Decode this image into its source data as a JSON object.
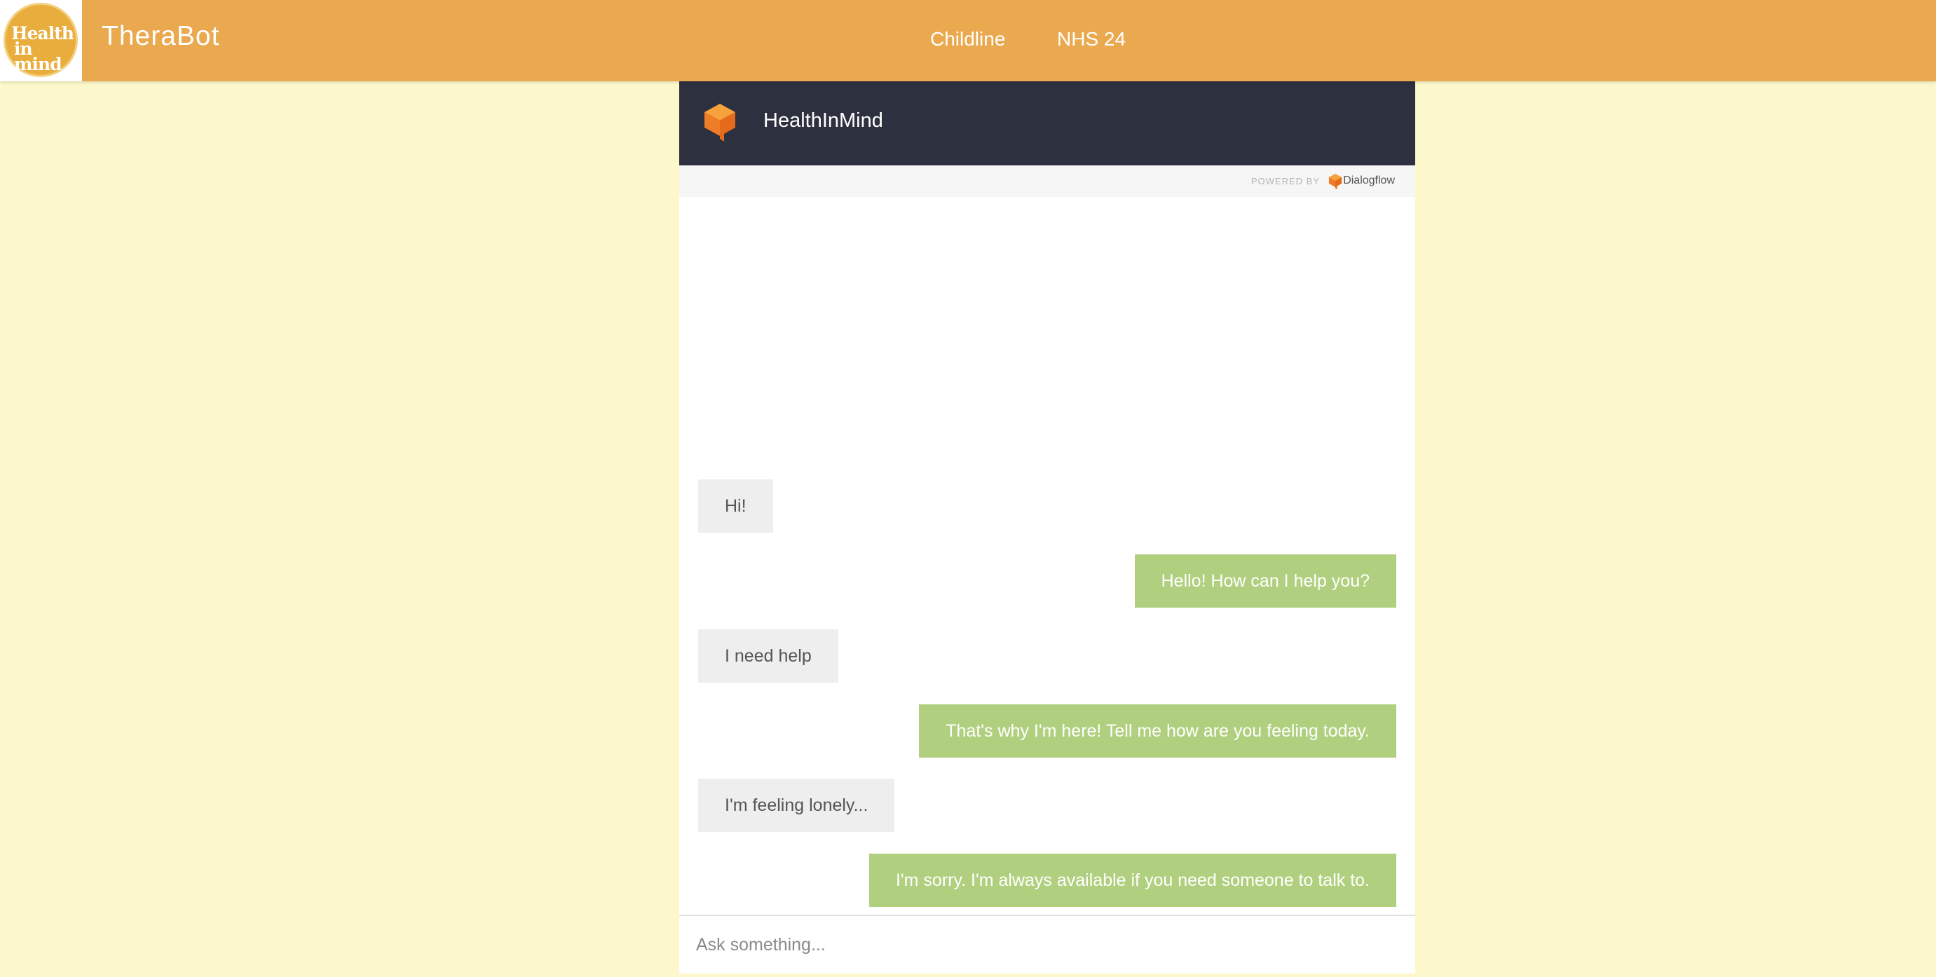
{
  "navbar": {
    "logo_text_line1": "Health",
    "logo_text_line2": "in mind",
    "brand": "TheraBot",
    "links": [
      {
        "label": "Childline"
      },
      {
        "label": "NHS 24"
      }
    ]
  },
  "chat": {
    "agent_name": "HealthInMind",
    "powered_by_label": "POWERED BY",
    "powered_by_brand": "Dialogflow",
    "messages": [
      {
        "sender": "user",
        "text": "Hi!"
      },
      {
        "sender": "bot",
        "text": "Hello! How can I help you?"
      },
      {
        "sender": "user",
        "text": "I need help"
      },
      {
        "sender": "bot",
        "text": "That's why I'm here! Tell me how are you feeling today."
      },
      {
        "sender": "user",
        "text": "I'm feeling lonely..."
      },
      {
        "sender": "bot",
        "text": "I'm sorry. I'm always available if you need someone to talk to."
      }
    ],
    "input": {
      "placeholder": "Ask something...",
      "value": ""
    }
  },
  "colors": {
    "navbar": "#eaa94f",
    "page_background": "#fdf8cc",
    "chat_header": "#2d303e",
    "user_bubble": "#eeeeee",
    "bot_bubble": "#b0d07f",
    "dialogflow_orange": "#ef7c27"
  },
  "icons": {
    "logo": "health-in-mind-logo",
    "agent": "dialogflow-cube-icon",
    "powered_by": "dialogflow-cube-icon"
  }
}
